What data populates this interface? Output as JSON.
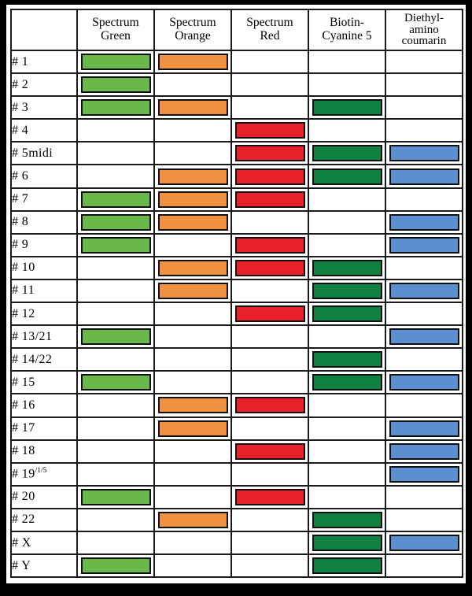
{
  "table": {
    "corner_header": "",
    "columns": [
      {
        "key": "spectrum_green",
        "lines": [
          "Spectrum",
          "Green"
        ]
      },
      {
        "key": "spectrum_orange",
        "lines": [
          "Spectrum",
          "Orange"
        ]
      },
      {
        "key": "spectrum_red",
        "lines": [
          "Spectrum",
          "Red"
        ]
      },
      {
        "key": "biotin_cyanine5",
        "lines": [
          "Biotin-",
          "Cyanine 5"
        ]
      },
      {
        "key": "diethylamino_coumarin",
        "lines": [
          "Diethyl-",
          "amino",
          "coumarin"
        ]
      }
    ],
    "colors": {
      "spectrum_green": "#6ab84a",
      "spectrum_orange": "#f2913f",
      "spectrum_red": "#e8202a",
      "biotin_cyanine5": "#0f8040",
      "diethylamino_coumarin": "#5b8fd0",
      "border": "#101010",
      "grid_line": "#1a1a1a",
      "frame": "#000000",
      "background": "#ffffff"
    },
    "rows": [
      {
        "label": "# 1",
        "label_sup": "",
        "marks": [
          true,
          true,
          false,
          false,
          false
        ]
      },
      {
        "label": "# 2",
        "label_sup": "",
        "marks": [
          true,
          false,
          false,
          false,
          false
        ]
      },
      {
        "label": "# 3",
        "label_sup": "",
        "marks": [
          true,
          true,
          false,
          true,
          false
        ]
      },
      {
        "label": "# 4",
        "label_sup": "",
        "marks": [
          false,
          false,
          true,
          false,
          false
        ]
      },
      {
        "label": "# 5midi",
        "label_sup": "",
        "marks": [
          false,
          false,
          true,
          true,
          true
        ]
      },
      {
        "label": "# 6",
        "label_sup": "",
        "marks": [
          false,
          true,
          true,
          true,
          true
        ]
      },
      {
        "label": "# 7",
        "label_sup": "",
        "marks": [
          true,
          true,
          true,
          false,
          false
        ]
      },
      {
        "label": "# 8",
        "label_sup": "",
        "marks": [
          true,
          true,
          false,
          false,
          true
        ]
      },
      {
        "label": "# 9",
        "label_sup": "",
        "marks": [
          true,
          false,
          true,
          false,
          true
        ]
      },
      {
        "label": "# 10",
        "label_sup": "",
        "marks": [
          false,
          true,
          true,
          true,
          false
        ]
      },
      {
        "label": "# 11",
        "label_sup": "",
        "marks": [
          false,
          true,
          false,
          true,
          true
        ]
      },
      {
        "label": "# 12",
        "label_sup": "",
        "marks": [
          false,
          false,
          true,
          true,
          false
        ]
      },
      {
        "label": "# 13/21",
        "label_sup": "",
        "marks": [
          true,
          false,
          false,
          false,
          true
        ]
      },
      {
        "label": "# 14/22",
        "label_sup": "",
        "marks": [
          false,
          false,
          false,
          true,
          false
        ]
      },
      {
        "label": "# 15",
        "label_sup": "",
        "marks": [
          true,
          false,
          false,
          true,
          true
        ]
      },
      {
        "label": "# 16",
        "label_sup": "",
        "marks": [
          false,
          true,
          true,
          false,
          false
        ]
      },
      {
        "label": "# 17",
        "label_sup": "",
        "marks": [
          false,
          true,
          false,
          false,
          true
        ]
      },
      {
        "label": "# 18",
        "label_sup": "",
        "marks": [
          false,
          false,
          true,
          false,
          true
        ]
      },
      {
        "label": "# 19",
        "label_sup": "/1/5",
        "marks": [
          false,
          false,
          false,
          false,
          true
        ]
      },
      {
        "label": "# 20",
        "label_sup": "",
        "marks": [
          true,
          false,
          true,
          false,
          false
        ]
      },
      {
        "label": "# 22",
        "label_sup": "",
        "marks": [
          false,
          true,
          false,
          true,
          false
        ]
      },
      {
        "label": "# X",
        "label_sup": "",
        "marks": [
          false,
          false,
          false,
          true,
          true
        ]
      },
      {
        "label": "# Y",
        "label_sup": "",
        "marks": [
          true,
          false,
          false,
          true,
          false
        ]
      }
    ]
  }
}
